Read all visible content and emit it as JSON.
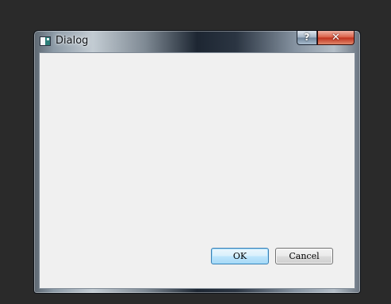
{
  "window": {
    "title": "Dialog",
    "help_glyph": "?",
    "close_glyph": "✕"
  },
  "icons": {
    "app": "dialog-app-icon",
    "help": "help-icon",
    "close": "close-icon"
  },
  "buttons": {
    "ok_label": "OK",
    "cancel_label": "Cancel"
  },
  "colors": {
    "close_button": "#c0301c",
    "default_button_border": "#3c7fb1",
    "dialog_background": "#f0f0f0",
    "desktop": "#2a2a2a"
  }
}
